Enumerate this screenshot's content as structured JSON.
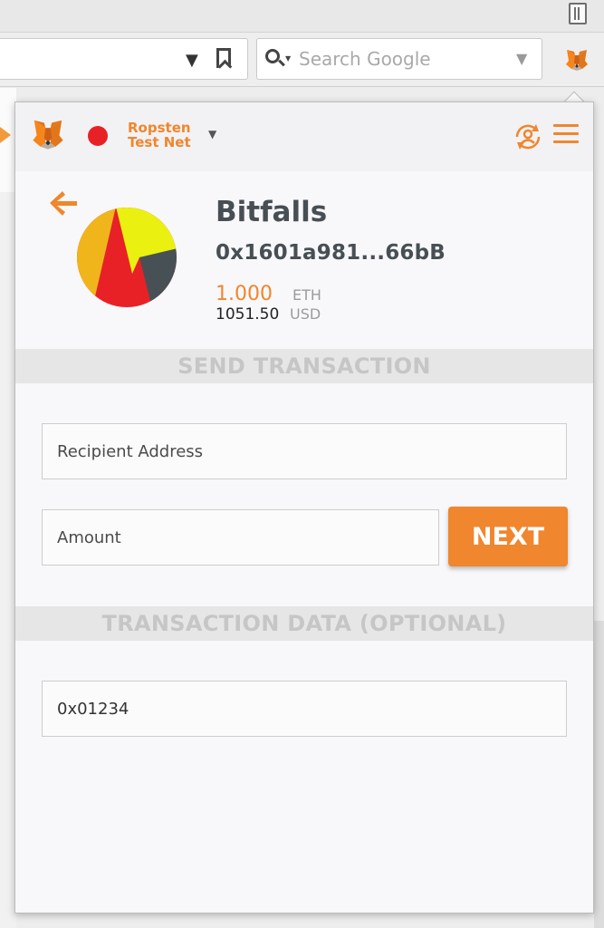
{
  "browser": {
    "search": {
      "placeholder": "Search Google"
    },
    "icons": {
      "menu": "library-icon",
      "url_dropdown": "dropdown-triangle-icon",
      "bookmark": "bookmark-icon",
      "search": "search-icon",
      "extension": "metamask-fox-icon"
    }
  },
  "header": {
    "network": "Ropsten Test Net",
    "network_dot_color": "#e82127",
    "accent": "#f0862d"
  },
  "account": {
    "name": "Bitfalls",
    "address": "0x1601a981...66bB",
    "eth_balance": "1.000",
    "eth_unit": "ETH",
    "usd_balance": "1051.50",
    "usd_unit": "USD",
    "identicon_colors": [
      "#eaf00f",
      "#e82127",
      "#475155",
      "#f0b51a"
    ]
  },
  "send": {
    "title": "SEND TRANSACTION",
    "recipient_placeholder": "Recipient Address",
    "amount_placeholder": "Amount",
    "next_label": "NEXT"
  },
  "data_section": {
    "title": "TRANSACTION DATA (OPTIONAL)",
    "value": "0x01234"
  }
}
